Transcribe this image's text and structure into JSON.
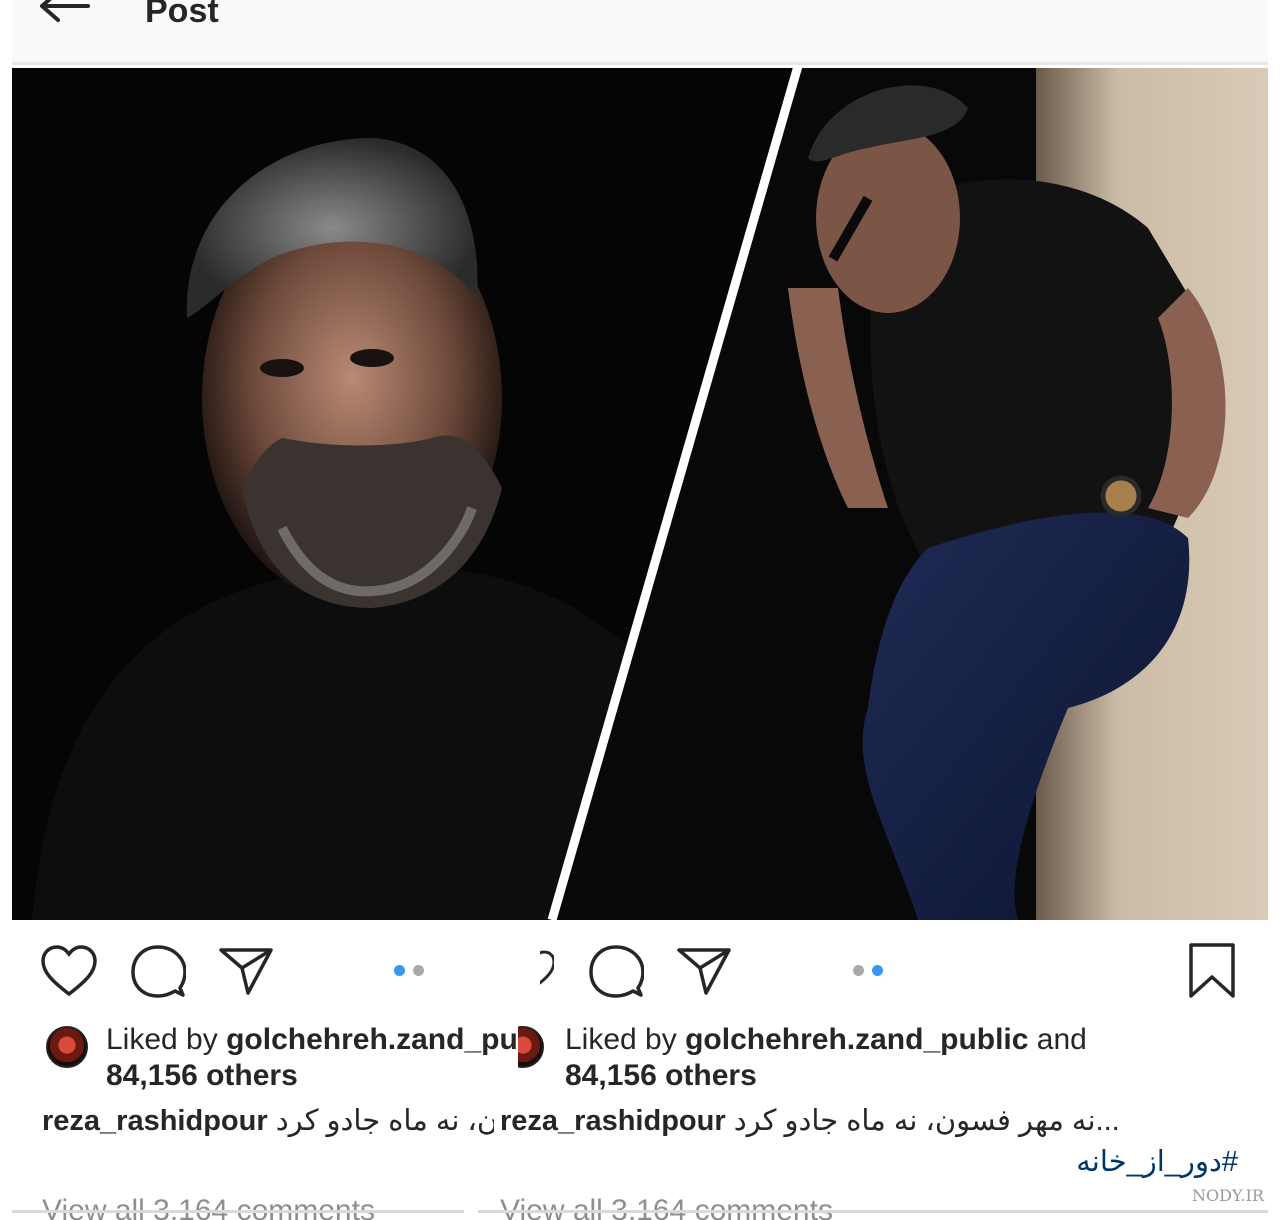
{
  "header": {
    "title": "Post"
  },
  "left_post": {
    "liked_by_prefix": "Liked by ",
    "liked_by_user": "golchehreh.zand_pu",
    "others": "84,156 others",
    "caption_user": "reza_rashidpour",
    "caption_text": "ون، نه ماه جادو کرد",
    "comments_link": "View all 3,164 comments"
  },
  "right_post": {
    "liked_by_prefix": "Liked by ",
    "liked_by_user": "golchehreh.zand_public",
    "liked_by_suffix": " and",
    "others": "84,156 others",
    "caption_user": "reza_rashidpour",
    "caption_text": "...نه مهر فسون، نه ماه جادو کرد",
    "hashtag": "#دور_از_خانه",
    "comments_link": "View all 3,164 comments"
  },
  "watermark": "NODY.IR",
  "icons": [
    "back-arrow-icon",
    "heart-icon",
    "comment-icon",
    "share-icon",
    "bookmark-icon"
  ],
  "colors": {
    "accent": "#3897f0",
    "hashtag": "#003569",
    "muted": "#8e8e8e"
  }
}
